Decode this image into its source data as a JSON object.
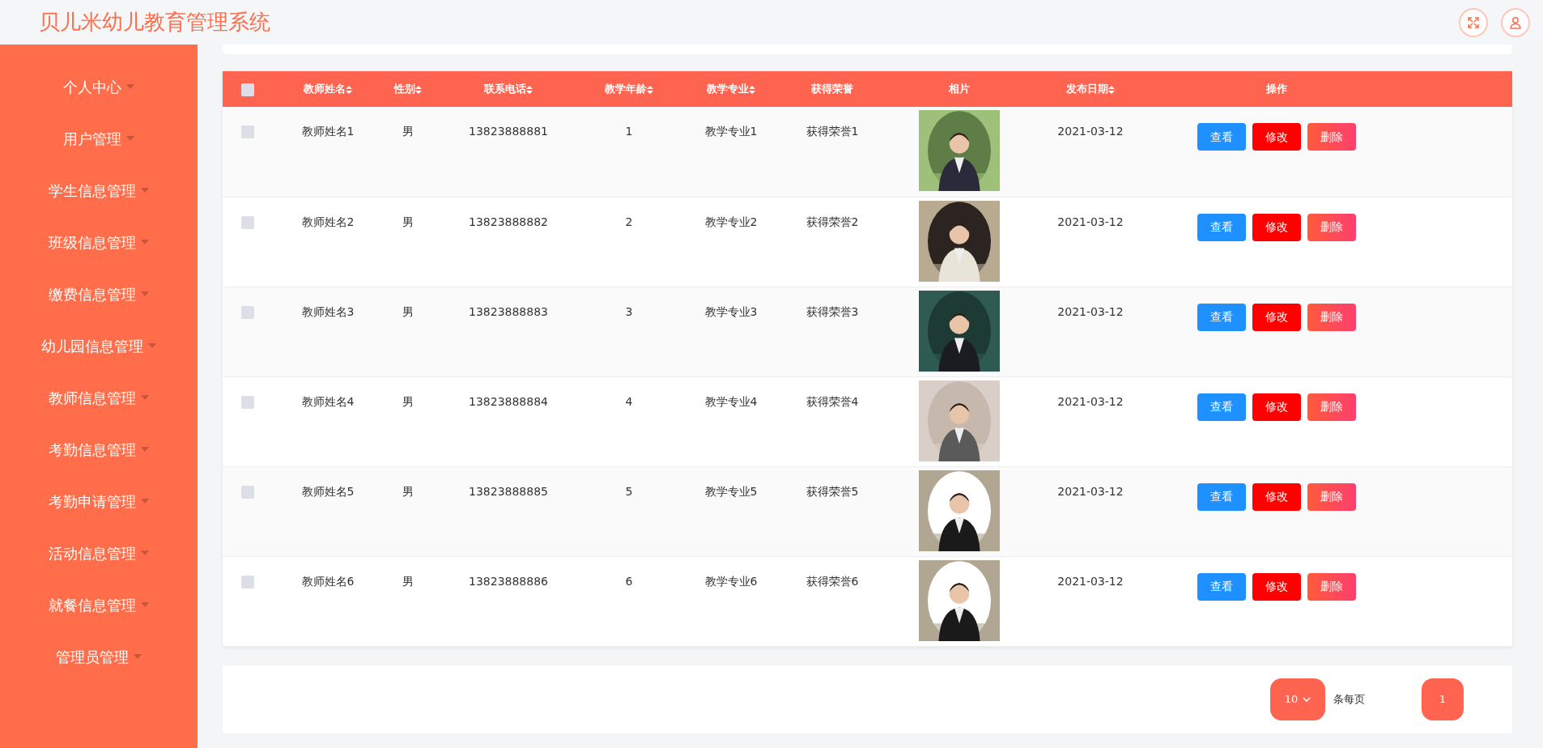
{
  "header": {
    "title": "贝儿米幼儿教育管理系统"
  },
  "sidebar": {
    "items": [
      {
        "label": "个人中心"
      },
      {
        "label": "用户管理"
      },
      {
        "label": "学生信息管理"
      },
      {
        "label": "班级信息管理"
      },
      {
        "label": "缴费信息管理"
      },
      {
        "label": "幼儿园信息管理"
      },
      {
        "label": "教师信息管理"
      },
      {
        "label": "考勤信息管理"
      },
      {
        "label": "考勤申请管理"
      },
      {
        "label": "活动信息管理"
      },
      {
        "label": "就餐信息管理"
      },
      {
        "label": "管理员管理"
      }
    ]
  },
  "table": {
    "select_all": {
      "checked": false
    },
    "columns": [
      {
        "label": "教师姓名",
        "sortable": true
      },
      {
        "label": "性别",
        "sortable": true
      },
      {
        "label": "联系电话",
        "sortable": true
      },
      {
        "label": "教学年龄",
        "sortable": true
      },
      {
        "label": "教学专业",
        "sortable": true
      },
      {
        "label": "获得荣誉",
        "sortable": false
      },
      {
        "label": "相片",
        "sortable": false
      },
      {
        "label": "发布日期",
        "sortable": true
      },
      {
        "label": "操作",
        "sortable": false
      }
    ],
    "rows": [
      {
        "checked": false,
        "name": "教师姓名1",
        "gender": "男",
        "phone": "13823888881",
        "age": "1",
        "major": "教学专业1",
        "honor": "获得荣誉1",
        "date": "2021-03-12",
        "actions": [
          "查看",
          "修改",
          "删除"
        ]
      },
      {
        "checked": false,
        "name": "教师姓名2",
        "gender": "男",
        "phone": "13823888882",
        "age": "2",
        "major": "教学专业2",
        "honor": "获得荣誉2",
        "date": "2021-03-12",
        "actions": [
          "查看",
          "修改",
          "删除"
        ]
      },
      {
        "checked": false,
        "name": "教师姓名3",
        "gender": "男",
        "phone": "13823888883",
        "age": "3",
        "major": "教学专业3",
        "honor": "获得荣誉3",
        "date": "2021-03-12",
        "actions": [
          "查看",
          "修改",
          "删除"
        ]
      },
      {
        "checked": false,
        "name": "教师姓名4",
        "gender": "男",
        "phone": "13823888884",
        "age": "4",
        "major": "教学专业4",
        "honor": "获得荣誉4",
        "date": "2021-03-12",
        "actions": [
          "查看",
          "修改",
          "删除"
        ]
      },
      {
        "checked": false,
        "name": "教师姓名5",
        "gender": "男",
        "phone": "13823888885",
        "age": "5",
        "major": "教学专业5",
        "honor": "获得荣誉5",
        "date": "2021-03-12",
        "actions": [
          "查看",
          "修改",
          "删除"
        ]
      },
      {
        "checked": false,
        "name": "教师姓名6",
        "gender": "男",
        "phone": "13823888886",
        "age": "6",
        "major": "教学专业6",
        "honor": "获得荣誉6",
        "date": "2021-03-12",
        "actions": [
          "查看",
          "修改",
          "删除"
        ]
      }
    ]
  },
  "pagination": {
    "page_size": "10",
    "page_size_label": "条每页",
    "pages": [
      {
        "label": "1",
        "selected": true
      }
    ]
  }
}
